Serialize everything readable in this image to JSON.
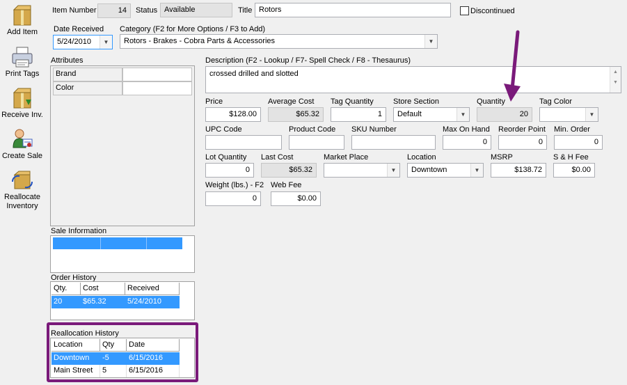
{
  "toolbar": [
    {
      "label": "Add Item",
      "icon": "add-item-icon"
    },
    {
      "label": "Print Tags",
      "icon": "print-tags-icon"
    },
    {
      "label": "Receive Inv.",
      "icon": "receive-inventory-icon"
    },
    {
      "label": "Create Sale",
      "icon": "create-sale-icon"
    },
    {
      "label": "Reallocate Inventory",
      "icon": "reallocate-inventory-icon"
    }
  ],
  "header": {
    "item_number_label": "Item Number",
    "item_number": "14",
    "status_label": "Status",
    "status": "Available",
    "title_label": "Title",
    "title": "Rotors",
    "discontinued_label": "Discontinued",
    "date_received_label": "Date Received",
    "date_received": "5/24/2010",
    "category_label": "Category (F2 for More Options / F3 to Add)",
    "category": "Rotors - Brakes - Cobra Parts & Accessories"
  },
  "attributes": {
    "title": "Attributes",
    "rows": [
      {
        "name": "Brand",
        "value": ""
      },
      {
        "name": "Color",
        "value": ""
      }
    ]
  },
  "description": {
    "label": "Description  (F2 - Lookup / F7- Spell Check / F8 - Thesaurus)",
    "value": "crossed drilled and slotted"
  },
  "fields": {
    "price_label": "Price",
    "price": "$128.00",
    "avg_cost_label": "Average Cost",
    "avg_cost": "$65.32",
    "tag_qty_label": "Tag Quantity",
    "tag_qty": "1",
    "store_section_label": "Store Section",
    "store_section": "Default",
    "quantity_label": "Quantity",
    "quantity": "20",
    "tag_color_label": "Tag Color",
    "tag_color": "",
    "upc_label": "UPC Code",
    "upc": "",
    "product_code_label": "Product Code",
    "product_code": "",
    "sku_label": "SKU Number",
    "sku": "",
    "max_on_hand_label": "Max On Hand",
    "max_on_hand": "0",
    "reorder_point_label": "Reorder Point",
    "reorder_point": "0",
    "min_order_label": "Min. Order",
    "min_order": "0",
    "lot_qty_label": "Lot Quantity",
    "lot_qty": "0",
    "last_cost_label": "Last Cost",
    "last_cost": "$65.32",
    "market_place_label": "Market Place",
    "market_place": "",
    "location_label": "Location",
    "location": "Downtown",
    "msrp_label": "MSRP",
    "msrp": "$138.72",
    "sh_fee_label": "S & H Fee",
    "sh_fee": "$0.00",
    "weight_label": "Weight (lbs.) - F2",
    "weight": "0",
    "web_fee_label": "Web Fee",
    "web_fee": "$0.00"
  },
  "sale_information": {
    "title": "Sale Information"
  },
  "order_history": {
    "title": "Order History",
    "columns": [
      "Qty.",
      "Cost",
      "Received"
    ],
    "rows": [
      [
        "20",
        "$65.32",
        "5/24/2010"
      ]
    ]
  },
  "reallocation_history": {
    "title": "Reallocation History",
    "columns": [
      "Location",
      "Qty",
      "Date"
    ],
    "rows": [
      [
        "Downtown",
        "-5",
        "6/15/2016"
      ],
      [
        "Main Street",
        "5",
        "6/15/2016"
      ]
    ]
  },
  "colors": {
    "selection": "#3399ff",
    "annotation": "#7a1a7a"
  }
}
